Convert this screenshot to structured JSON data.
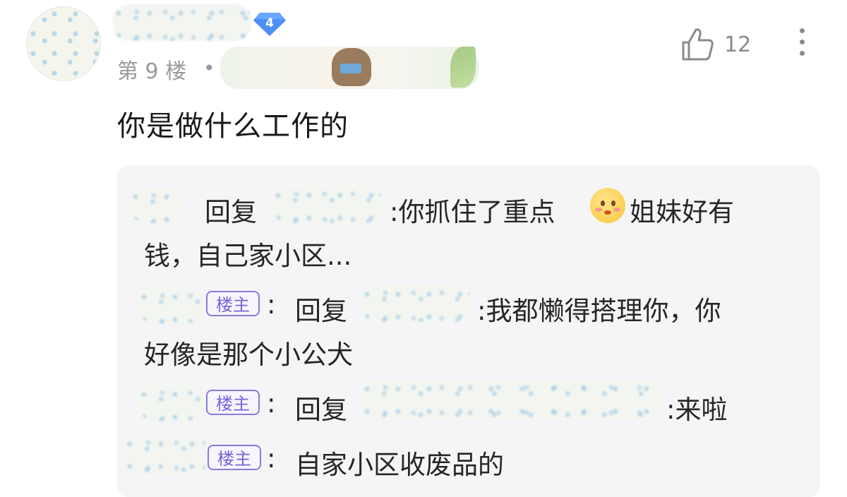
{
  "post": {
    "level": "4",
    "floor_label": "第 9 楼",
    "separator": "•",
    "likes": "12",
    "text": "你是做什么工作的"
  },
  "icons": {
    "like": "thumbs-up-icon",
    "more": "more-vertical-icon",
    "level": "diamond-level-badge-icon",
    "emoji": "blushing-face-emoji"
  },
  "colors": {
    "host_tag": "#7b63d8",
    "reply_bg": "#f5f5f7",
    "meta_text": "#9a9a9a",
    "level_badge": "#4d8ff5"
  },
  "replies": [
    {
      "reply_word": "回复",
      "text_part1": ":你抓住了重点",
      "text_part2": "姐妹好有",
      "text_line2": "钱，自己家小区..."
    },
    {
      "host_tag": "楼主",
      "colon": ":",
      "reply_word": "回复",
      "text_part1": ":我都懒得搭理你，你",
      "text_line2": "好像是那个小公犬"
    },
    {
      "host_tag": "楼主",
      "colon": ":",
      "reply_word": "回复",
      "text_part1": ":来啦"
    },
    {
      "host_tag": "楼主",
      "colon": ":",
      "text_part1": "自家小区收废品的"
    }
  ]
}
